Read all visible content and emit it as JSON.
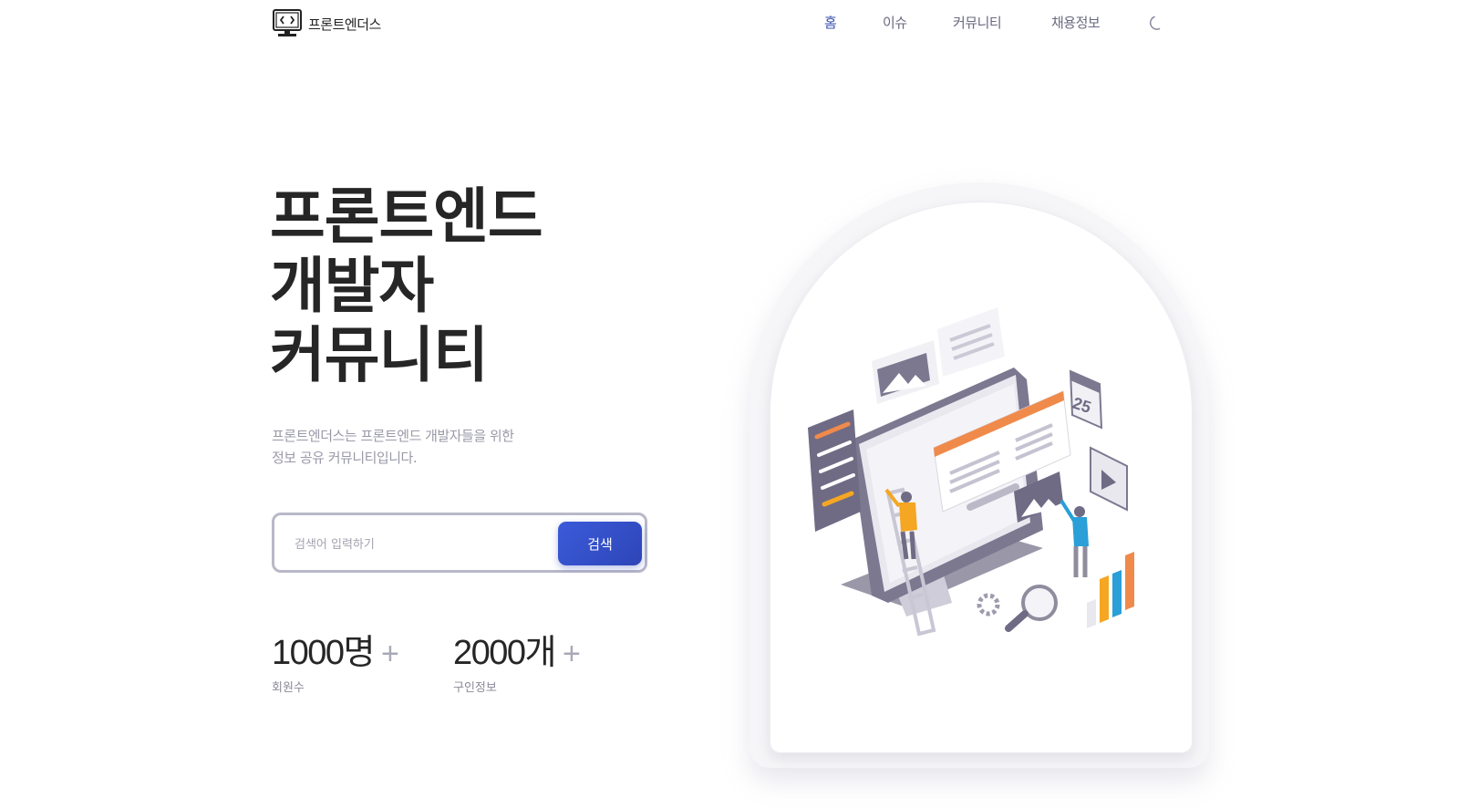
{
  "header": {
    "logo_text": "프론트엔더스",
    "nav": [
      {
        "label": "홈",
        "active": true
      },
      {
        "label": "이슈",
        "active": false
      },
      {
        "label": "커뮤니티",
        "active": false
      },
      {
        "label": "채용정보",
        "active": false
      }
    ],
    "theme_icon": "moon-icon"
  },
  "hero": {
    "title_lines": [
      "프론트엔드",
      "개발자",
      "커뮤니티"
    ],
    "description_lines": [
      "프론트엔더스는 프론트엔드 개발자들을 위한",
      "정보 공유 커뮤니티입니다."
    ]
  },
  "search": {
    "placeholder": "검색어 입력하기",
    "value": "",
    "button_label": "검색"
  },
  "stats": [
    {
      "value": "1000명",
      "suffix": "+",
      "label": "회원수"
    },
    {
      "value": "2000개",
      "suffix": "+",
      "label": "구인정보"
    }
  ],
  "colors": {
    "accent": "#3b5bd9",
    "nav_active": "#3a52b0",
    "orange": "#f08a4b",
    "blue": "#2a9fd8"
  },
  "illustration": {
    "calendar_number": "25",
    "icon": "developer-workspace-illustration"
  }
}
